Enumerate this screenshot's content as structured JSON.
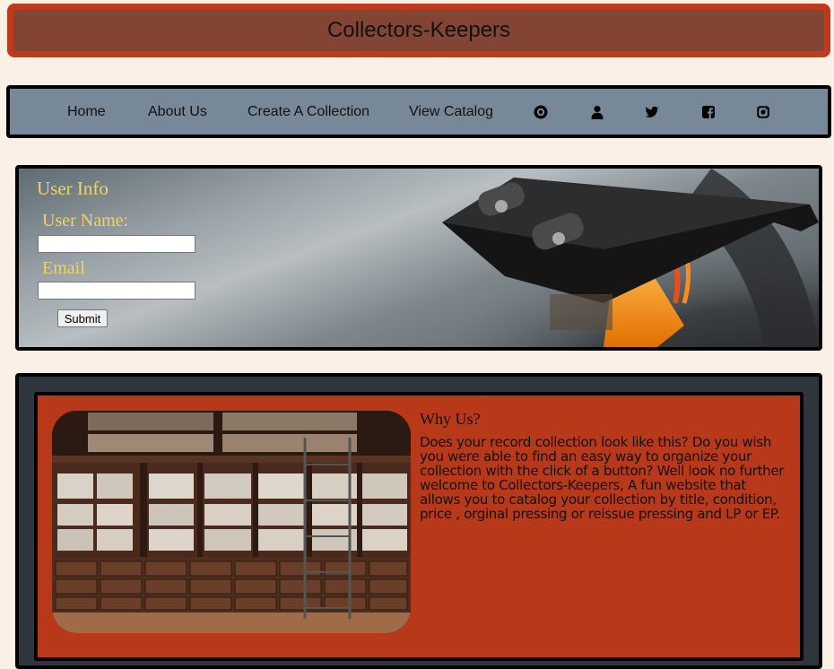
{
  "header": {
    "title": "Collectors-Keepers"
  },
  "nav": {
    "links": [
      "Home",
      "About Us",
      "Create A Collection",
      "View Catalog"
    ],
    "icons": [
      "record-icon",
      "user-icon",
      "twitter-icon",
      "facebook-icon",
      "instagram-icon"
    ]
  },
  "user_form": {
    "title": "User Info",
    "username_label": "User Name:",
    "username_value": "",
    "email_label": "Email",
    "email_value": "",
    "submit_label": "Submit"
  },
  "why_us": {
    "title": "Why Us?",
    "body": "Does your record collection look like this? Do you wish you were able to find an easy way to organize your collection with the click of a button? Well look no further welcome to Collectors-Keepers, A fun website that allows you to catalog your collection by title, condition, price , orginal pressing or reissue pressing and LP or EP."
  },
  "colors": {
    "page_bg": "#faf0e6",
    "header_border": "#c0391b",
    "header_bg": "#824534",
    "nav_bg": "#778899",
    "label_gold": "#f0d264",
    "why_outer_bg": "#2f353c",
    "why_inner_bg": "#b8391a"
  }
}
